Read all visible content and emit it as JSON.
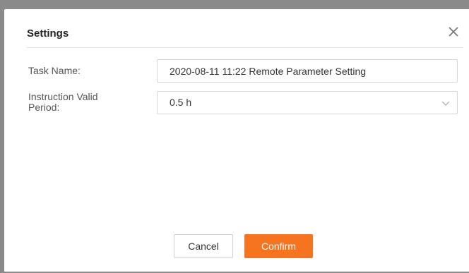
{
  "dialog": {
    "title": "Settings",
    "close_icon": "close-icon"
  },
  "form": {
    "task_name": {
      "label": "Task Name:",
      "value": "2020-08-11 11:22 Remote Parameter Setting"
    },
    "valid_period": {
      "label_line1": "Instruction Valid",
      "label_line2": "Period:",
      "selected": "0.5 h",
      "icon": "chevron-down-icon"
    }
  },
  "actions": {
    "cancel_label": "Cancel",
    "confirm_label": "Confirm"
  },
  "colors": {
    "accent": "#f6731f",
    "backdrop": "#8a8a8a"
  }
}
